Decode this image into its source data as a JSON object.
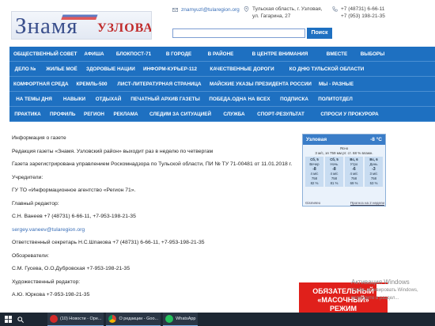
{
  "header": {
    "logo_main": "Знамя",
    "logo_sub": "УЗЛОВАЯ",
    "email": "znamyuzl@tularegion.org",
    "address": [
      "Тульская область, г. Узловая,",
      "ул. Гагарина, 27"
    ],
    "phones": [
      "+7 (48731) 6-66-11",
      "+7 (953) 198-21-35"
    ],
    "search_value": "",
    "search_button": "Поиск"
  },
  "nav": {
    "rows": [
      [
        "ОБЩЕСТВЕННЫЙ СОВЕТ",
        "АФИША",
        "БЛОКПОСТ-71",
        "В ГОРОДЕ",
        "В РАЙОНЕ",
        "В ЦЕНТРЕ ВНИМАНИЯ",
        "ВМЕСТЕ",
        "ВЫБОРЫ"
      ],
      [
        "ДЕЛО №",
        "ЖИЛЬЕ МОЁ",
        "ЗДОРОВЫЕ НАЦИИ",
        "ИНФОРМ-КУРЬЕР-112",
        "КАЧЕСТВЕННЫЕ ДОРОГИ",
        "КО ДНЮ ТУЛЬСКОЙ ОБЛАСТИ"
      ],
      [
        "КОМФОРТНАЯ СРЕДА",
        "КРЕМЛЬ-500",
        "ЛИСТ-ЛИТЕРАТУРНАЯ СТРАНИЦА",
        "МАЙСКИЕ УКАЗЫ ПРЕЗИДЕНТА РОССИИ",
        "МЫ - РАЗНЫЕ"
      ],
      [
        "НА ТЕМЫ ДНЯ",
        "НАВЫКИ",
        "ОТДЫХАЙ",
        "ПЕЧАТНЫЙ АРХИВ ГАЗЕТЫ",
        "ПОБЕДА.ОДНА НА ВСЕХ",
        "ПОДПИСКА",
        "ПОЛИТОТДЕЛ"
      ],
      [
        "ПРАКТИКА",
        "ПРОФИЛЬ",
        "РЕГИОН",
        "РЕКЛАМА",
        "СЛЕДИМ ЗА СИТУАЦИЕЙ",
        "СЛУЖБА",
        "СПОРТ-РЕЗУЛЬТАТ",
        "СПРОСИ У ПРОКУРОРА"
      ]
    ]
  },
  "content": {
    "paragraphs": [
      "Информация о газете",
      "Редакция газеты «Знамя. Узловский район» выходит раз в неделю по четвергам",
      "Газета зарегистрирована управлением Роскомнадзора по Тульской области, ПИ № ТУ 71-00481 от 11.01.2018 г.",
      "Учредители:",
      "ГУ ТО «Информационное агентство «Регион 71».",
      "Главный редактор:",
      "С.Н. Ванеев +7 (48731) 6-66-11, +7-953-198-21-35",
      "sergey.vaneev@tularegion.org",
      "Ответственный секретарь Н.С.Шпакова +7 (48731) 6-66-11, +7-953-198-21-35",
      "Обозреватели:",
      "С.М. Гусева, О.О.Дубровская +7-953-198-21-35",
      "Художественный редактор:",
      "А.Ю. Юркова  +7-953-198-21-35"
    ]
  },
  "weather": {
    "city": "Узловая",
    "temp": "-8 °C",
    "now_label": "Ясно",
    "now_details": "3 м/с, зя   759 мм рт. ст.   68 % влажн.",
    "days": [
      {
        "date": "Сб, 5",
        "period": "Вечер",
        "temp": "-8",
        "details": [
          "4 м/с",
          "758",
          "82 %"
        ]
      },
      {
        "date": "Сб, 5",
        "period": "Ночь",
        "temp": "-8",
        "details": [
          "4 м/с",
          "758",
          "81 %"
        ]
      },
      {
        "date": "Вс, 6",
        "period": "Утро",
        "temp": "-6",
        "details": [
          "4 м/с",
          "758",
          "69 %"
        ]
      },
      {
        "date": "Вс, 6",
        "period": "День",
        "temp": "-3",
        "details": [
          "3 м/с",
          "758",
          "53 %"
        ]
      }
    ],
    "brand": "Gismeteo",
    "forecast_link": "Прогноз на 2 недели"
  },
  "ad": {
    "lines": [
      "ОБЯЗАТЕЛЬНЫЙ",
      "«МАСОЧНЫЙ»",
      "РЕЖИМ"
    ]
  },
  "watermark": {
    "line1": "Активация Windows",
    "line2": "Чтобы активировать Windows, перейдите в раздел..."
  },
  "taskbar": {
    "items": [
      {
        "label": "(10) Новости - Ope...",
        "color": "#d32a2a"
      },
      {
        "label": "О редакции - Goo...",
        "color": "#f0b418"
      },
      {
        "label": "WhatsApp",
        "color": "#25c15c"
      }
    ]
  }
}
